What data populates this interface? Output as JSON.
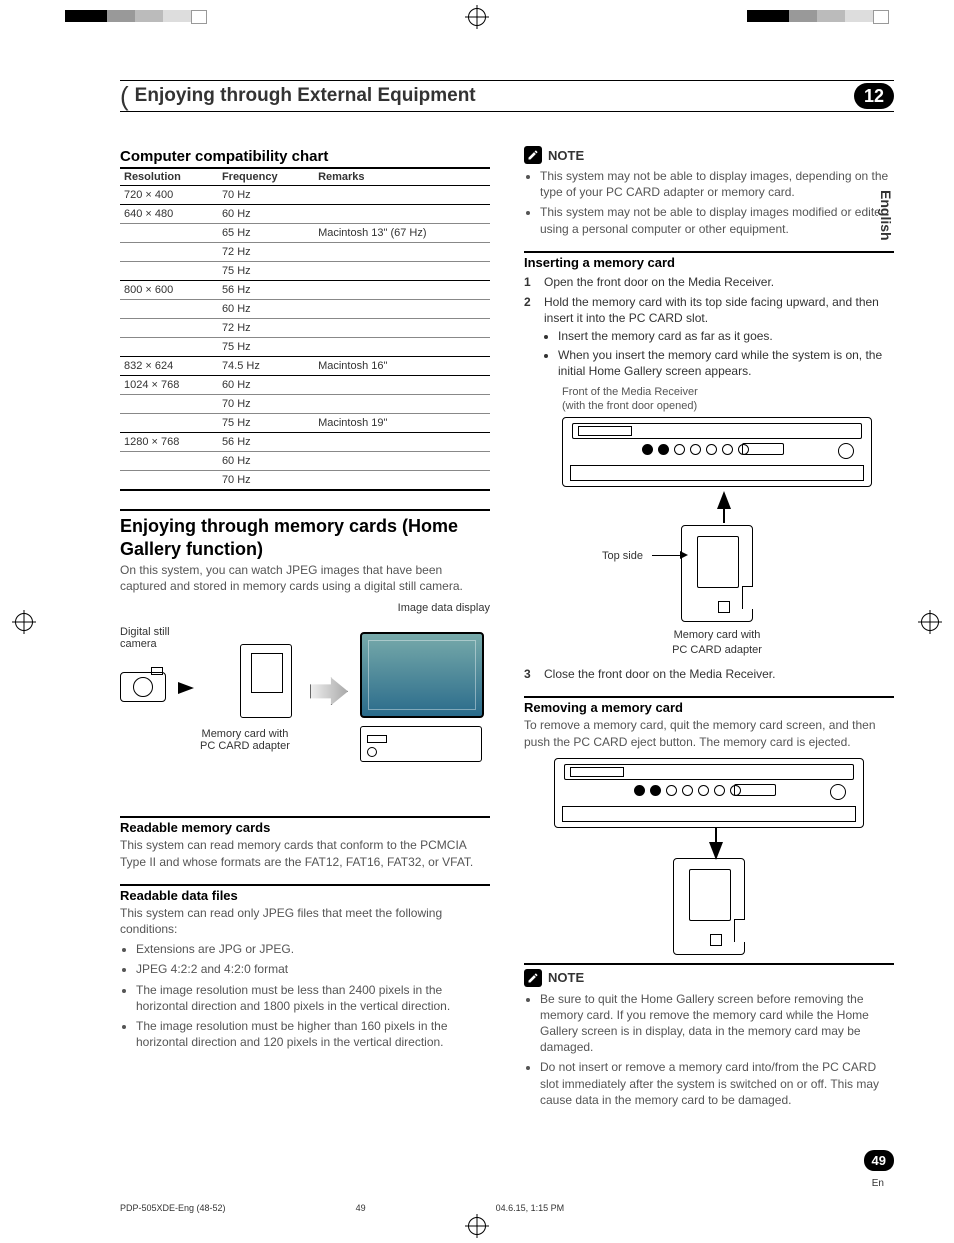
{
  "chapter": {
    "title": "Enjoying through External Equipment",
    "number": "12"
  },
  "lang_tab": "English",
  "page_number": "49",
  "page_number_lang": "En",
  "left": {
    "compat_heading": "Computer compatibility chart",
    "table": {
      "headers": [
        "Resolution",
        "Frequency",
        "Remarks"
      ],
      "rows": [
        {
          "res": "720 × 400",
          "freq": "70 Hz",
          "rem": ""
        },
        {
          "res": "640 × 480",
          "freq": "60 Hz",
          "rem": ""
        },
        {
          "res": "",
          "freq": "65 Hz",
          "rem": "Macintosh 13\" (67 Hz)"
        },
        {
          "res": "",
          "freq": "72 Hz",
          "rem": ""
        },
        {
          "res": "",
          "freq": "75 Hz",
          "rem": ""
        },
        {
          "res": "800 × 600",
          "freq": "56 Hz",
          "rem": ""
        },
        {
          "res": "",
          "freq": "60 Hz",
          "rem": ""
        },
        {
          "res": "",
          "freq": "72 Hz",
          "rem": ""
        },
        {
          "res": "",
          "freq": "75 Hz",
          "rem": ""
        },
        {
          "res": "832 × 624",
          "freq": "74.5 Hz",
          "rem": "Macintosh 16\""
        },
        {
          "res": "1024 × 768",
          "freq": "60 Hz",
          "rem": ""
        },
        {
          "res": "",
          "freq": "70 Hz",
          "rem": ""
        },
        {
          "res": "",
          "freq": "75 Hz",
          "rem": "Macintosh 19\""
        },
        {
          "res": "1280 × 768",
          "freq": "56 Hz",
          "rem": ""
        },
        {
          "res": "",
          "freq": "60 Hz",
          "rem": ""
        },
        {
          "res": "",
          "freq": "70 Hz",
          "rem": ""
        }
      ]
    },
    "big_heading": "Enjoying through memory cards (Home Gallery function)",
    "big_para": "On this system, you can watch JPEG images that have been captured and stored in memory cards using a digital still camera.",
    "illus": {
      "camera": "Digital still\ncamera",
      "card": "Memory card with\nPC CARD adapter",
      "display": "Image data display"
    },
    "readable_cards_h": "Readable memory cards",
    "readable_cards_p": "This system can read memory cards that conform to the PCMCIA Type II and whose formats are the FAT12, FAT16, FAT32, or VFAT.",
    "readable_files_h": "Readable data files",
    "readable_files_p": "This system can read only JPEG files that meet the following conditions:",
    "readable_files_li": [
      "Extensions are JPG or JPEG.",
      "JPEG 4:2:2 and 4:2:0 format",
      "The image resolution must be less than 2400 pixels in the horizontal direction and 1800 pixels in the vertical direction.",
      "The image resolution must be higher than 160 pixels in the horizontal direction and 120 pixels in the vertical direction."
    ]
  },
  "right": {
    "note1_label": "NOTE",
    "note1_li": [
      "This system may not be able to display images, depending on the type of your PC CARD adapter or memory card.",
      "This system may not be able to display images modified or edited using a personal computer or other equipment."
    ],
    "insert_h": "Inserting a memory card",
    "insert_steps": {
      "s1": "Open the front door on the Media Receiver.",
      "s2": "Hold the memory card with its top side facing upward, and then insert it into the PC CARD slot.",
      "s2_sub": [
        "Insert the memory card as far as it goes.",
        "When you insert the memory card while the system is on, the initial Home Gallery screen appears."
      ],
      "s2_caption": "Front of the Media Receiver\n(with the front door opened)",
      "s2_topside": "Top side",
      "s2_cardlabel": "Memory card with\nPC CARD adapter",
      "s3": "Close the front door on the Media Receiver."
    },
    "remove_h": "Removing a memory card",
    "remove_p": "To remove a memory card, quit the memory card screen, and then push the PC CARD eject button. The memory card is ejected.",
    "note2_label": "NOTE",
    "note2_li": [
      "Be sure to quit the Home Gallery screen before removing the memory card. If you remove the memory card while the Home Gallery screen is in display, data in the memory card may be damaged.",
      "Do not insert or remove a memory card into/from the PC CARD slot immediately after the system is switched on or off. This may cause data in the memory card to be damaged."
    ]
  },
  "footer": {
    "doc": "PDP-505XDE-Eng (48-52)",
    "pg": "49",
    "date": "04.6.15, 1:15 PM"
  }
}
